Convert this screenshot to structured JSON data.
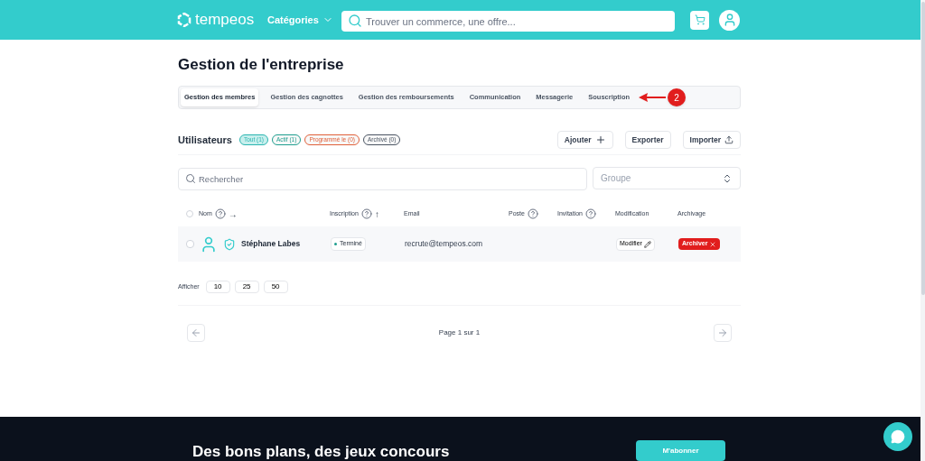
{
  "header": {
    "logo": "tempeos",
    "categories": "Catégories",
    "search_placeholder": "Trouver un commerce, une offre..."
  },
  "page_title": "Gestion de l'entreprise",
  "tabs": [
    {
      "label": "Gestion des membres",
      "selected": true
    },
    {
      "label": "Gestion des cagnottes",
      "selected": false
    },
    {
      "label": "Gestion des remboursements",
      "selected": false
    },
    {
      "label": "Communication",
      "selected": false
    },
    {
      "label": "Messagerie",
      "selected": false
    },
    {
      "label": "Souscription",
      "selected": false
    }
  ],
  "annotation": {
    "label": "2"
  },
  "users": {
    "title": "Utilisateurs",
    "filters": [
      {
        "label": "Tout (1)",
        "selected": true,
        "color": "#2ab5b0"
      },
      {
        "label": "Actif (1)",
        "selected": false,
        "color": "#1f9e8f"
      },
      {
        "label": "Programmé le (0)",
        "selected": false,
        "color": "#e0603a"
      },
      {
        "label": "Archivé (0)",
        "selected": false,
        "color": "#4b5563"
      }
    ],
    "actions": [
      {
        "label": "Ajouter",
        "kind": "add"
      },
      {
        "label": "Exporter",
        "kind": "plain"
      },
      {
        "label": "Importer",
        "kind": "import"
      }
    ]
  },
  "search": {
    "placeholder": "Rechercher"
  },
  "group_select": {
    "placeholder": "Groupe"
  },
  "table": {
    "all_checked": false,
    "columns": [
      {
        "label": "Nom",
        "help": true,
        "sort_arrow": "→"
      },
      {
        "label": "Inscription",
        "help": true,
        "sort_arrow": "↑"
      },
      {
        "label": "Email",
        "help": false
      },
      {
        "label": "Poste",
        "help": true
      },
      {
        "label": "Invitation",
        "help": true
      },
      {
        "label": "Modification",
        "help": false
      },
      {
        "label": "Archivage",
        "help": false
      }
    ],
    "rows": [
      {
        "checked": false,
        "name": "Stéphane Labes",
        "status": "Terminé",
        "email": "recrute@tempeos.com",
        "edit": "Modifier",
        "archive": "Archiver"
      }
    ]
  },
  "page_size": {
    "label": "Afficher",
    "options": [
      "10",
      "25",
      "50"
    ]
  },
  "pagination": {
    "text": "Page 1 sur 1"
  },
  "footer": {
    "headline": "Des bons plans, des jeux concours",
    "button": "M'abonner"
  }
}
